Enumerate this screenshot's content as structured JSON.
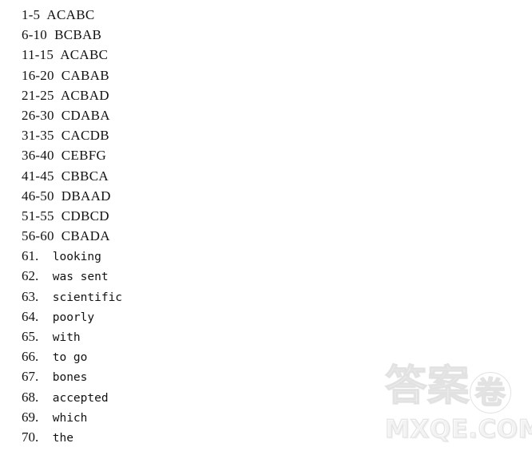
{
  "document": {
    "type": "answer-key",
    "background_color": "#ffffff",
    "text_color": "#121212"
  },
  "answers": {
    "grouped": [
      {
        "range": "1-5",
        "letters": "ACABC"
      },
      {
        "range": "6-10",
        "letters": "BCBAB"
      },
      {
        "range": "11-15",
        "letters": "ACABC"
      },
      {
        "range": "16-20",
        "letters": "CABAB"
      },
      {
        "range": "21-25",
        "letters": "ACBAD"
      },
      {
        "range": "26-30",
        "letters": "CDABA"
      },
      {
        "range": "31-35",
        "letters": "CACDB"
      },
      {
        "range": "36-40",
        "letters": "CEBFG"
      },
      {
        "range": "41-45",
        "letters": "CBBCA"
      },
      {
        "range": "46-50",
        "letters": "DBAAD"
      },
      {
        "range": "51-55",
        "letters": "CDBCD"
      },
      {
        "range": "56-60",
        "letters": "CBADA"
      }
    ],
    "single": [
      {
        "number": "61.",
        "word": "looking"
      },
      {
        "number": "62.",
        "word": "was sent"
      },
      {
        "number": "63.",
        "word": "scientific"
      },
      {
        "number": "64.",
        "word": "poorly"
      },
      {
        "number": "65.",
        "word": "with"
      },
      {
        "number": "66.",
        "word": "to go"
      },
      {
        "number": "67.",
        "word": "bones"
      },
      {
        "number": "68.",
        "word": "accepted"
      },
      {
        "number": "69.",
        "word": "which"
      },
      {
        "number": "70.",
        "word": "the"
      }
    ]
  },
  "watermark": {
    "cjk_prefix": "答案",
    "cjk_circled": "卷",
    "domain": "MXQE.COM",
    "color": "#e3e3e3"
  }
}
